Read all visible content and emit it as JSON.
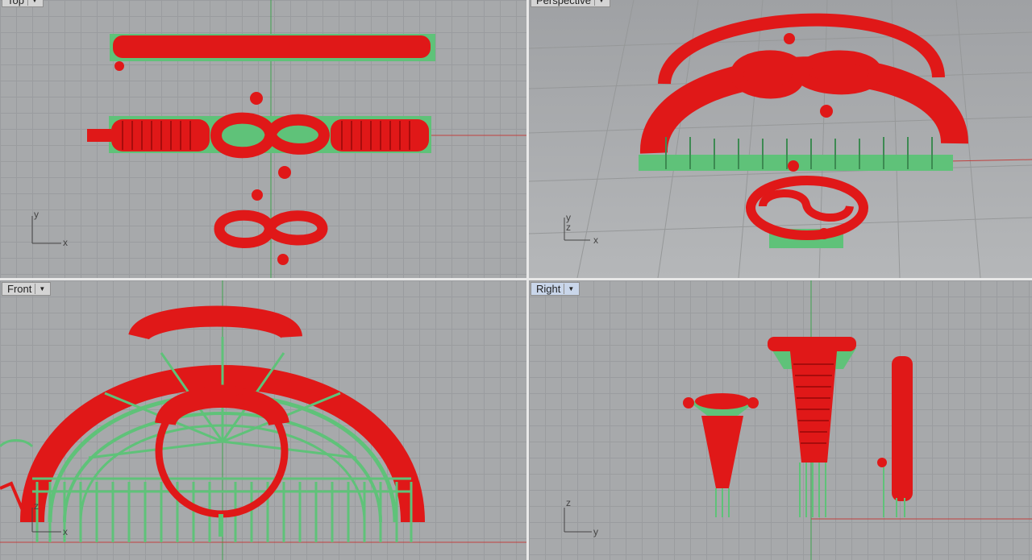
{
  "viewports": {
    "top": {
      "label": "Top"
    },
    "perspective": {
      "label": "Perspective"
    },
    "front": {
      "label": "Front"
    },
    "right": {
      "label": "Right"
    }
  },
  "axes": {
    "top": {
      "h": "x",
      "v": "y"
    },
    "perspective": {
      "h": "x",
      "v": "y",
      "v2": "z"
    },
    "front": {
      "h": "x",
      "v": "z"
    },
    "right": {
      "h": "y",
      "v": "z"
    }
  },
  "colors": {
    "model": "#e01818",
    "support": "#5fc279",
    "grid": "#a7a9ab",
    "axis_x": "#c0413f",
    "axis_y": "#3fa24f"
  },
  "icons": {
    "dropdown": "chevron-down-icon"
  }
}
